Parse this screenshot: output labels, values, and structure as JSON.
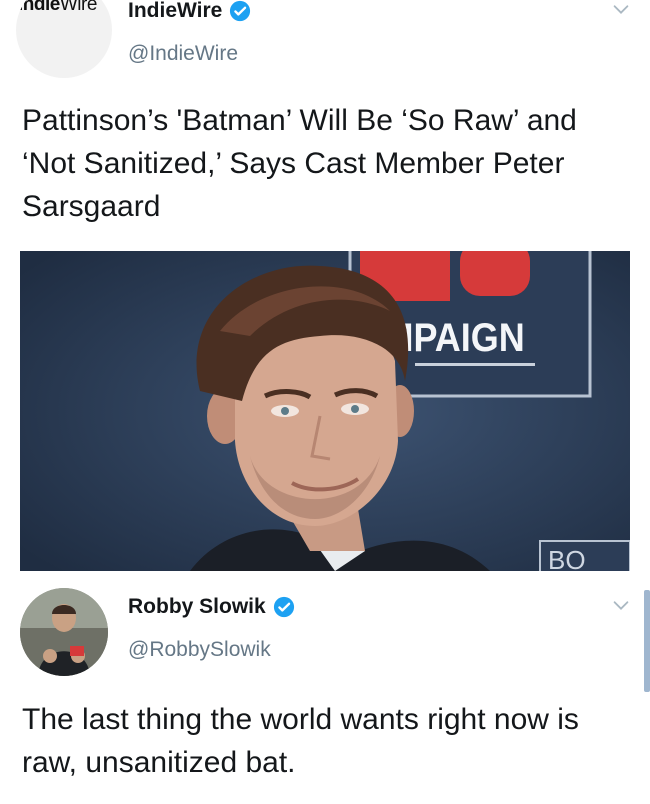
{
  "tweet1": {
    "avatar_logo": {
      "bold": "Indie",
      "light": "Wire"
    },
    "display_name": "IndieWire",
    "handle": "@IndieWire",
    "text": "Pattinson’s 'Batman’ Will Be ‘So Raw’ and ‘Not Sanitized,’ Says Cast Member Peter Sarsgaard",
    "photo": {
      "backdrop_text": "AMPAIGN",
      "backdrop_corner_text": "BO"
    }
  },
  "tweet2": {
    "display_name": "Robby Slowik",
    "handle": "@RobbySlowik",
    "text": "The last thing the world wants right now is raw, unsanitized bat."
  },
  "colors": {
    "verified": "#1da1f2",
    "handle": "#657786",
    "text": "#14171a",
    "chevron": "#aab8c2"
  },
  "icons": [
    "verified-badge-icon",
    "chevron-down-icon"
  ]
}
